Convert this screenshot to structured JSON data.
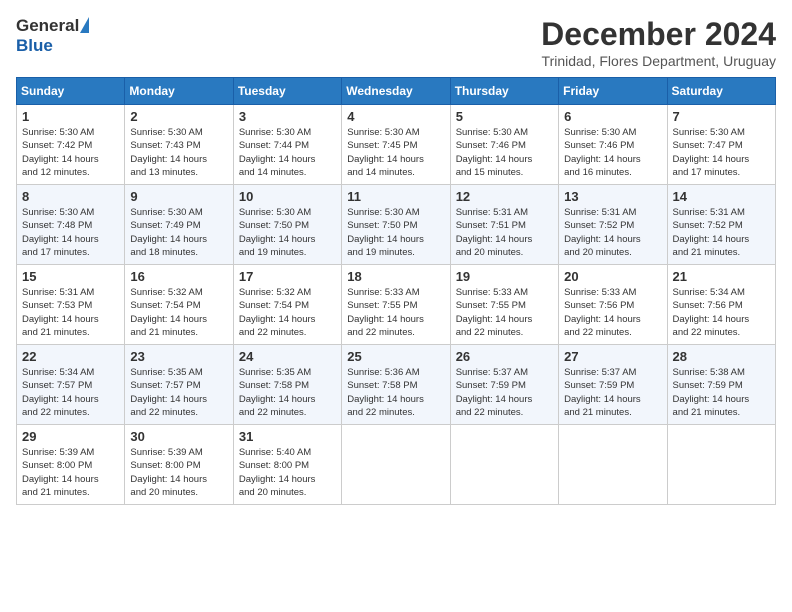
{
  "header": {
    "logo_general": "General",
    "logo_blue": "Blue",
    "month_title": "December 2024",
    "location": "Trinidad, Flores Department, Uruguay"
  },
  "calendar": {
    "days_of_week": [
      "Sunday",
      "Monday",
      "Tuesday",
      "Wednesday",
      "Thursday",
      "Friday",
      "Saturday"
    ],
    "weeks": [
      [
        {
          "day": "",
          "sunrise": "",
          "sunset": "",
          "daylight": ""
        },
        {
          "day": "2",
          "sunrise": "Sunrise: 5:30 AM",
          "sunset": "Sunset: 7:43 PM",
          "daylight": "Daylight: 14 hours and 13 minutes."
        },
        {
          "day": "3",
          "sunrise": "Sunrise: 5:30 AM",
          "sunset": "Sunset: 7:44 PM",
          "daylight": "Daylight: 14 hours and 14 minutes."
        },
        {
          "day": "4",
          "sunrise": "Sunrise: 5:30 AM",
          "sunset": "Sunset: 7:45 PM",
          "daylight": "Daylight: 14 hours and 14 minutes."
        },
        {
          "day": "5",
          "sunrise": "Sunrise: 5:30 AM",
          "sunset": "Sunset: 7:46 PM",
          "daylight": "Daylight: 14 hours and 15 minutes."
        },
        {
          "day": "6",
          "sunrise": "Sunrise: 5:30 AM",
          "sunset": "Sunset: 7:46 PM",
          "daylight": "Daylight: 14 hours and 16 minutes."
        },
        {
          "day": "7",
          "sunrise": "Sunrise: 5:30 AM",
          "sunset": "Sunset: 7:47 PM",
          "daylight": "Daylight: 14 hours and 17 minutes."
        }
      ],
      [
        {
          "day": "1",
          "sunrise": "Sunrise: 5:30 AM",
          "sunset": "Sunset: 7:42 PM",
          "daylight": "Daylight: 14 hours and 12 minutes."
        },
        null,
        null,
        null,
        null,
        null,
        null
      ],
      [
        {
          "day": "8",
          "sunrise": "Sunrise: 5:30 AM",
          "sunset": "Sunset: 7:48 PM",
          "daylight": "Daylight: 14 hours and 17 minutes."
        },
        {
          "day": "9",
          "sunrise": "Sunrise: 5:30 AM",
          "sunset": "Sunset: 7:49 PM",
          "daylight": "Daylight: 14 hours and 18 minutes."
        },
        {
          "day": "10",
          "sunrise": "Sunrise: 5:30 AM",
          "sunset": "Sunset: 7:50 PM",
          "daylight": "Daylight: 14 hours and 19 minutes."
        },
        {
          "day": "11",
          "sunrise": "Sunrise: 5:30 AM",
          "sunset": "Sunset: 7:50 PM",
          "daylight": "Daylight: 14 hours and 19 minutes."
        },
        {
          "day": "12",
          "sunrise": "Sunrise: 5:31 AM",
          "sunset": "Sunset: 7:51 PM",
          "daylight": "Daylight: 14 hours and 20 minutes."
        },
        {
          "day": "13",
          "sunrise": "Sunrise: 5:31 AM",
          "sunset": "Sunset: 7:52 PM",
          "daylight": "Daylight: 14 hours and 20 minutes."
        },
        {
          "day": "14",
          "sunrise": "Sunrise: 5:31 AM",
          "sunset": "Sunset: 7:52 PM",
          "daylight": "Daylight: 14 hours and 21 minutes."
        }
      ],
      [
        {
          "day": "15",
          "sunrise": "Sunrise: 5:31 AM",
          "sunset": "Sunset: 7:53 PM",
          "daylight": "Daylight: 14 hours and 21 minutes."
        },
        {
          "day": "16",
          "sunrise": "Sunrise: 5:32 AM",
          "sunset": "Sunset: 7:54 PM",
          "daylight": "Daylight: 14 hours and 21 minutes."
        },
        {
          "day": "17",
          "sunrise": "Sunrise: 5:32 AM",
          "sunset": "Sunset: 7:54 PM",
          "daylight": "Daylight: 14 hours and 22 minutes."
        },
        {
          "day": "18",
          "sunrise": "Sunrise: 5:33 AM",
          "sunset": "Sunset: 7:55 PM",
          "daylight": "Daylight: 14 hours and 22 minutes."
        },
        {
          "day": "19",
          "sunrise": "Sunrise: 5:33 AM",
          "sunset": "Sunset: 7:55 PM",
          "daylight": "Daylight: 14 hours and 22 minutes."
        },
        {
          "day": "20",
          "sunrise": "Sunrise: 5:33 AM",
          "sunset": "Sunset: 7:56 PM",
          "daylight": "Daylight: 14 hours and 22 minutes."
        },
        {
          "day": "21",
          "sunrise": "Sunrise: 5:34 AM",
          "sunset": "Sunset: 7:56 PM",
          "daylight": "Daylight: 14 hours and 22 minutes."
        }
      ],
      [
        {
          "day": "22",
          "sunrise": "Sunrise: 5:34 AM",
          "sunset": "Sunset: 7:57 PM",
          "daylight": "Daylight: 14 hours and 22 minutes."
        },
        {
          "day": "23",
          "sunrise": "Sunrise: 5:35 AM",
          "sunset": "Sunset: 7:57 PM",
          "daylight": "Daylight: 14 hours and 22 minutes."
        },
        {
          "day": "24",
          "sunrise": "Sunrise: 5:35 AM",
          "sunset": "Sunset: 7:58 PM",
          "daylight": "Daylight: 14 hours and 22 minutes."
        },
        {
          "day": "25",
          "sunrise": "Sunrise: 5:36 AM",
          "sunset": "Sunset: 7:58 PM",
          "daylight": "Daylight: 14 hours and 22 minutes."
        },
        {
          "day": "26",
          "sunrise": "Sunrise: 5:37 AM",
          "sunset": "Sunset: 7:59 PM",
          "daylight": "Daylight: 14 hours and 22 minutes."
        },
        {
          "day": "27",
          "sunrise": "Sunrise: 5:37 AM",
          "sunset": "Sunset: 7:59 PM",
          "daylight": "Daylight: 14 hours and 21 minutes."
        },
        {
          "day": "28",
          "sunrise": "Sunrise: 5:38 AM",
          "sunset": "Sunset: 7:59 PM",
          "daylight": "Daylight: 14 hours and 21 minutes."
        }
      ],
      [
        {
          "day": "29",
          "sunrise": "Sunrise: 5:39 AM",
          "sunset": "Sunset: 8:00 PM",
          "daylight": "Daylight: 14 hours and 21 minutes."
        },
        {
          "day": "30",
          "sunrise": "Sunrise: 5:39 AM",
          "sunset": "Sunset: 8:00 PM",
          "daylight": "Daylight: 14 hours and 20 minutes."
        },
        {
          "day": "31",
          "sunrise": "Sunrise: 5:40 AM",
          "sunset": "Sunset: 8:00 PM",
          "daylight": "Daylight: 14 hours and 20 minutes."
        },
        {
          "day": "",
          "sunrise": "",
          "sunset": "",
          "daylight": ""
        },
        {
          "day": "",
          "sunrise": "",
          "sunset": "",
          "daylight": ""
        },
        {
          "day": "",
          "sunrise": "",
          "sunset": "",
          "daylight": ""
        },
        {
          "day": "",
          "sunrise": "",
          "sunset": "",
          "daylight": ""
        }
      ]
    ]
  }
}
